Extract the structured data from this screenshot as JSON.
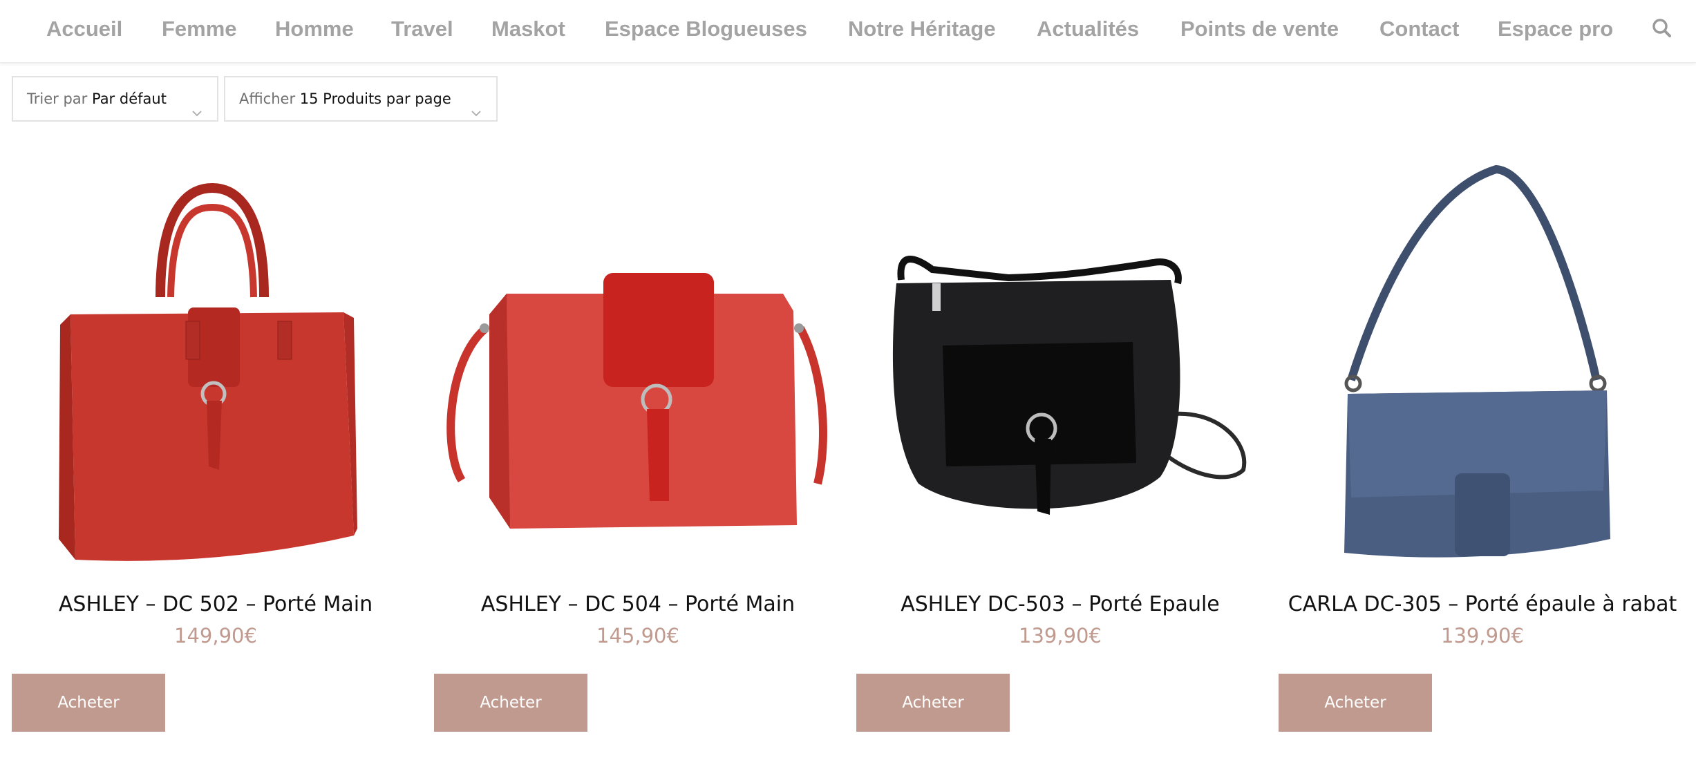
{
  "nav": {
    "items": [
      "Accueil",
      "Femme",
      "Homme",
      "Travel",
      "Maskot",
      "Espace Blogueuses",
      "Notre Héritage",
      "Actualités",
      "Points de vente",
      "Contact",
      "Espace pro"
    ],
    "search_icon": "search-icon"
  },
  "sorting": {
    "orderby_prefix": "Trier par",
    "orderby_value": "Par défaut",
    "perpage_prefix": "Afficher",
    "perpage_value": "15 Produits par page"
  },
  "products": [
    {
      "title": "ASHLEY – DC 502 – Porté Main",
      "price": "149,90€",
      "button": "Acheter",
      "color": "#c8372e"
    },
    {
      "title": "ASHLEY – DC 504 – Porté Main",
      "price": "145,90€",
      "button": "Acheter",
      "color": "#d33c35"
    },
    {
      "title": "ASHLEY DC-503 – Porté Epaule",
      "price": "139,90€",
      "button": "Acheter",
      "color": "#1b1b1d"
    },
    {
      "title": "CARLA DC-305 – Porté épaule à rabat",
      "price": "139,90€",
      "button": "Acheter",
      "color": "#44587a"
    }
  ],
  "colors": {
    "accent": "#c09a8f",
    "nav_text": "#a3a3a3"
  }
}
